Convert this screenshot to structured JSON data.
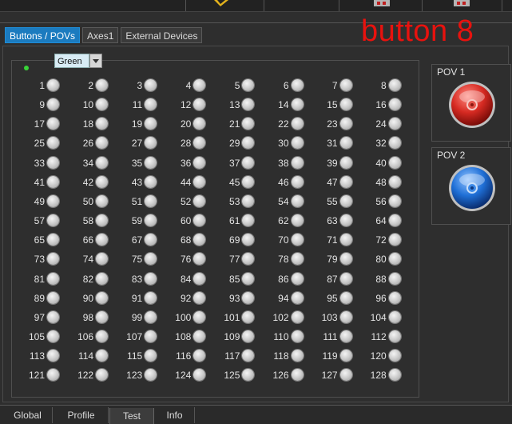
{
  "annotation": {
    "text": "button 8",
    "color": "#e8120e"
  },
  "tabs": [
    {
      "label": "Buttons / POVs",
      "active": true
    },
    {
      "label": "Axes1",
      "active": false
    },
    {
      "label": "External Devices",
      "active": false
    }
  ],
  "color_select": {
    "value": "Green"
  },
  "status_indicator_color": "#38d438",
  "buttons": [
    "1",
    "2",
    "3",
    "4",
    "5",
    "6",
    "7",
    "8",
    "9",
    "10",
    "11",
    "12",
    "13",
    "14",
    "15",
    "16",
    "17",
    "18",
    "19",
    "20",
    "21",
    "22",
    "23",
    "24",
    "25",
    "26",
    "27",
    "28",
    "29",
    "30",
    "31",
    "32",
    "33",
    "34",
    "35",
    "36",
    "37",
    "38",
    "39",
    "40",
    "41",
    "42",
    "43",
    "44",
    "45",
    "46",
    "47",
    "48",
    "49",
    "50",
    "51",
    "52",
    "53",
    "54",
    "55",
    "56",
    "57",
    "58",
    "59",
    "60",
    "61",
    "62",
    "63",
    "64",
    "65",
    "66",
    "67",
    "68",
    "69",
    "70",
    "71",
    "72",
    "73",
    "74",
    "75",
    "76",
    "77",
    "78",
    "79",
    "80",
    "81",
    "82",
    "83",
    "84",
    "85",
    "86",
    "87",
    "88",
    "89",
    "90",
    "91",
    "92",
    "93",
    "94",
    "95",
    "96",
    "97",
    "98",
    "99",
    "100",
    "101",
    "102",
    "103",
    "104",
    "105",
    "106",
    "107",
    "108",
    "109",
    "110",
    "111",
    "112",
    "113",
    "114",
    "115",
    "116",
    "117",
    "118",
    "119",
    "120",
    "121",
    "122",
    "123",
    "124",
    "125",
    "126",
    "127",
    "128"
  ],
  "povs": [
    {
      "title": "POV 1",
      "color": "#d62a22",
      "icon": "pov-hat-icon"
    },
    {
      "title": "POV 2",
      "color": "#1f6fd6",
      "icon": "pov-hat-icon"
    }
  ],
  "bottom_tabs": [
    {
      "label": "Global",
      "active": false
    },
    {
      "label": "Profile",
      "active": false
    },
    {
      "label": "Test",
      "active": true
    },
    {
      "label": "Info",
      "active": false
    }
  ]
}
